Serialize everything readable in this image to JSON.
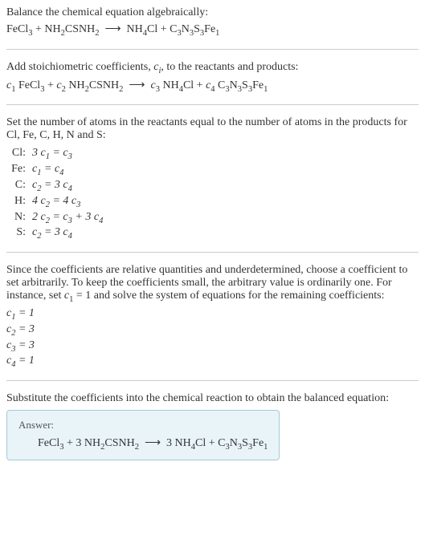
{
  "section1": {
    "title": "Balance the chemical equation algebraically:",
    "equation_html": "FeCl<sub>3</sub> + NH<sub>2</sub>CSNH<sub>2</sub> &nbsp;⟶&nbsp; NH<sub>4</sub>Cl + C<sub>3</sub>N<sub>3</sub>S<sub>3</sub>Fe<sub>1</sub>"
  },
  "section2": {
    "title_html": "Add stoichiometric coefficients, <span class='italic'>c<sub>i</sub></span>, to the reactants and products:",
    "equation_html": "<span class='italic'>c</span><sub>1</sub> FeCl<sub>3</sub> + <span class='italic'>c</span><sub>2</sub> NH<sub>2</sub>CSNH<sub>2</sub> &nbsp;⟶&nbsp; <span class='italic'>c</span><sub>3</sub> NH<sub>4</sub>Cl + <span class='italic'>c</span><sub>4</sub> C<sub>3</sub>N<sub>3</sub>S<sub>3</sub>Fe<sub>1</sub>"
  },
  "section3": {
    "title": "Set the number of atoms in the reactants equal to the number of atoms in the products for Cl, Fe, C, H, N and S:",
    "rows": [
      {
        "label": "Cl:",
        "eq_html": "3 <span class='italic'>c</span><sub>1</sub> = <span class='italic'>c</span><sub>3</sub>"
      },
      {
        "label": "Fe:",
        "eq_html": "<span class='italic'>c</span><sub>1</sub> = <span class='italic'>c</span><sub>4</sub>"
      },
      {
        "label": "C:",
        "eq_html": "<span class='italic'>c</span><sub>2</sub> = 3 <span class='italic'>c</span><sub>4</sub>"
      },
      {
        "label": "H:",
        "eq_html": "4 <span class='italic'>c</span><sub>2</sub> = 4 <span class='italic'>c</span><sub>3</sub>"
      },
      {
        "label": "N:",
        "eq_html": "2 <span class='italic'>c</span><sub>2</sub> = <span class='italic'>c</span><sub>3</sub> + 3 <span class='italic'>c</span><sub>4</sub>"
      },
      {
        "label": "S:",
        "eq_html": "<span class='italic'>c</span><sub>2</sub> = 3 <span class='italic'>c</span><sub>4</sub>"
      }
    ]
  },
  "section4": {
    "title_html": "Since the coefficients are relative quantities and underdetermined, choose a coefficient to set arbitrarily. To keep the coefficients small, the arbitrary value is ordinarily one. For instance, set <span class='italic'>c</span><sub>1</sub> = 1 and solve the system of equations for the remaining coefficients:",
    "coeffs": [
      {
        "html": "<span class='italic'>c</span><sub>1</sub> = 1"
      },
      {
        "html": "<span class='italic'>c</span><sub>2</sub> = 3"
      },
      {
        "html": "<span class='italic'>c</span><sub>3</sub> = 3"
      },
      {
        "html": "<span class='italic'>c</span><sub>4</sub> = 1"
      }
    ]
  },
  "section5": {
    "title": "Substitute the coefficients into the chemical reaction to obtain the balanced equation:",
    "answer_label": "Answer:",
    "answer_html": "FeCl<sub>3</sub> + 3 NH<sub>2</sub>CSNH<sub>2</sub> &nbsp;⟶&nbsp; 3 NH<sub>4</sub>Cl + C<sub>3</sub>N<sub>3</sub>S<sub>3</sub>Fe<sub>1</sub>"
  }
}
